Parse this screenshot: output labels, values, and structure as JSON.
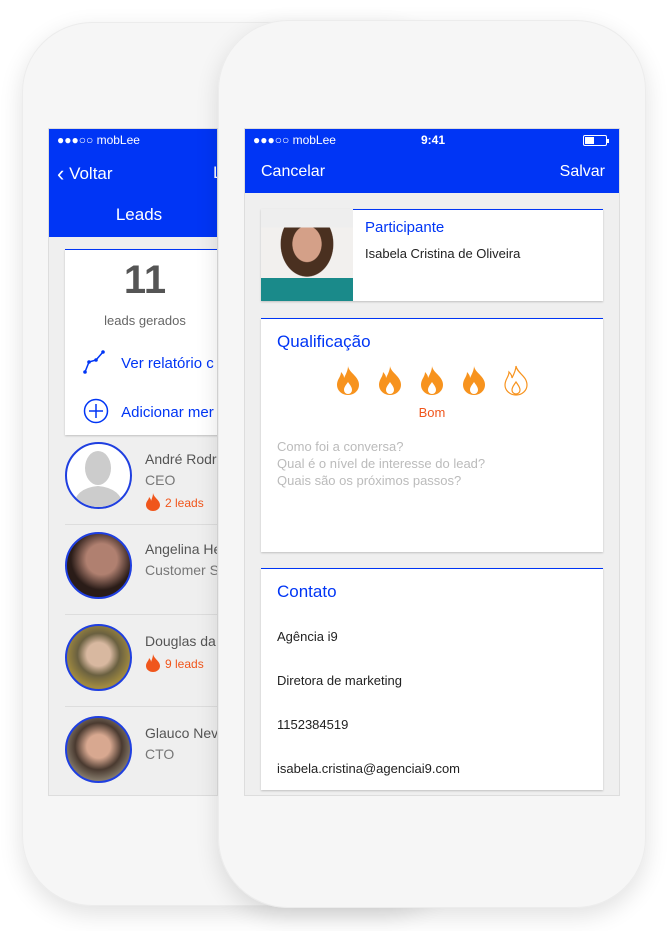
{
  "back_screen": {
    "status": {
      "carrier": "●●●○○ mobLee"
    },
    "nav": {
      "back_label": "Voltar",
      "partial_title": "L"
    },
    "tab": {
      "label": "Leads"
    },
    "summary": {
      "count": "11",
      "count_label": "leads gerados",
      "report_link": "Ver relatório c",
      "add_link": "Adicionar mer"
    },
    "members": [
      {
        "name": "André Rodri",
        "role": "CEO",
        "leads": "2 leads"
      },
      {
        "name": "Angelina He",
        "role": "Customer S",
        "leads": ""
      },
      {
        "name": "Douglas da",
        "role": "",
        "leads": "9 leads"
      },
      {
        "name": "Glauco Nev",
        "role": "CTO",
        "leads": ""
      }
    ]
  },
  "front_screen": {
    "status": {
      "carrier": "●●●○○ mobLee",
      "time": "9:41"
    },
    "nav": {
      "cancel": "Cancelar",
      "save": "Salvar"
    },
    "participant": {
      "heading": "Participante",
      "name": "Isabela Cristina de Oliveira"
    },
    "qualification": {
      "heading": "Qualificação",
      "rating": 4,
      "max": 5,
      "rating_label": "Bom",
      "placeholder_lines": [
        "Como foi a conversa?",
        "Qual é o nível de interesse do lead?",
        "Quais são os próximos passos?"
      ]
    },
    "contact": {
      "heading": "Contato",
      "company": "Agência i9",
      "role": "Diretora de marketing",
      "phone": "1152384519",
      "email": "isabela.cristina@agenciai9.com"
    }
  },
  "colors": {
    "accent": "#0035f5",
    "flame": "#f7931e",
    "lead_flame": "#f0561c"
  }
}
